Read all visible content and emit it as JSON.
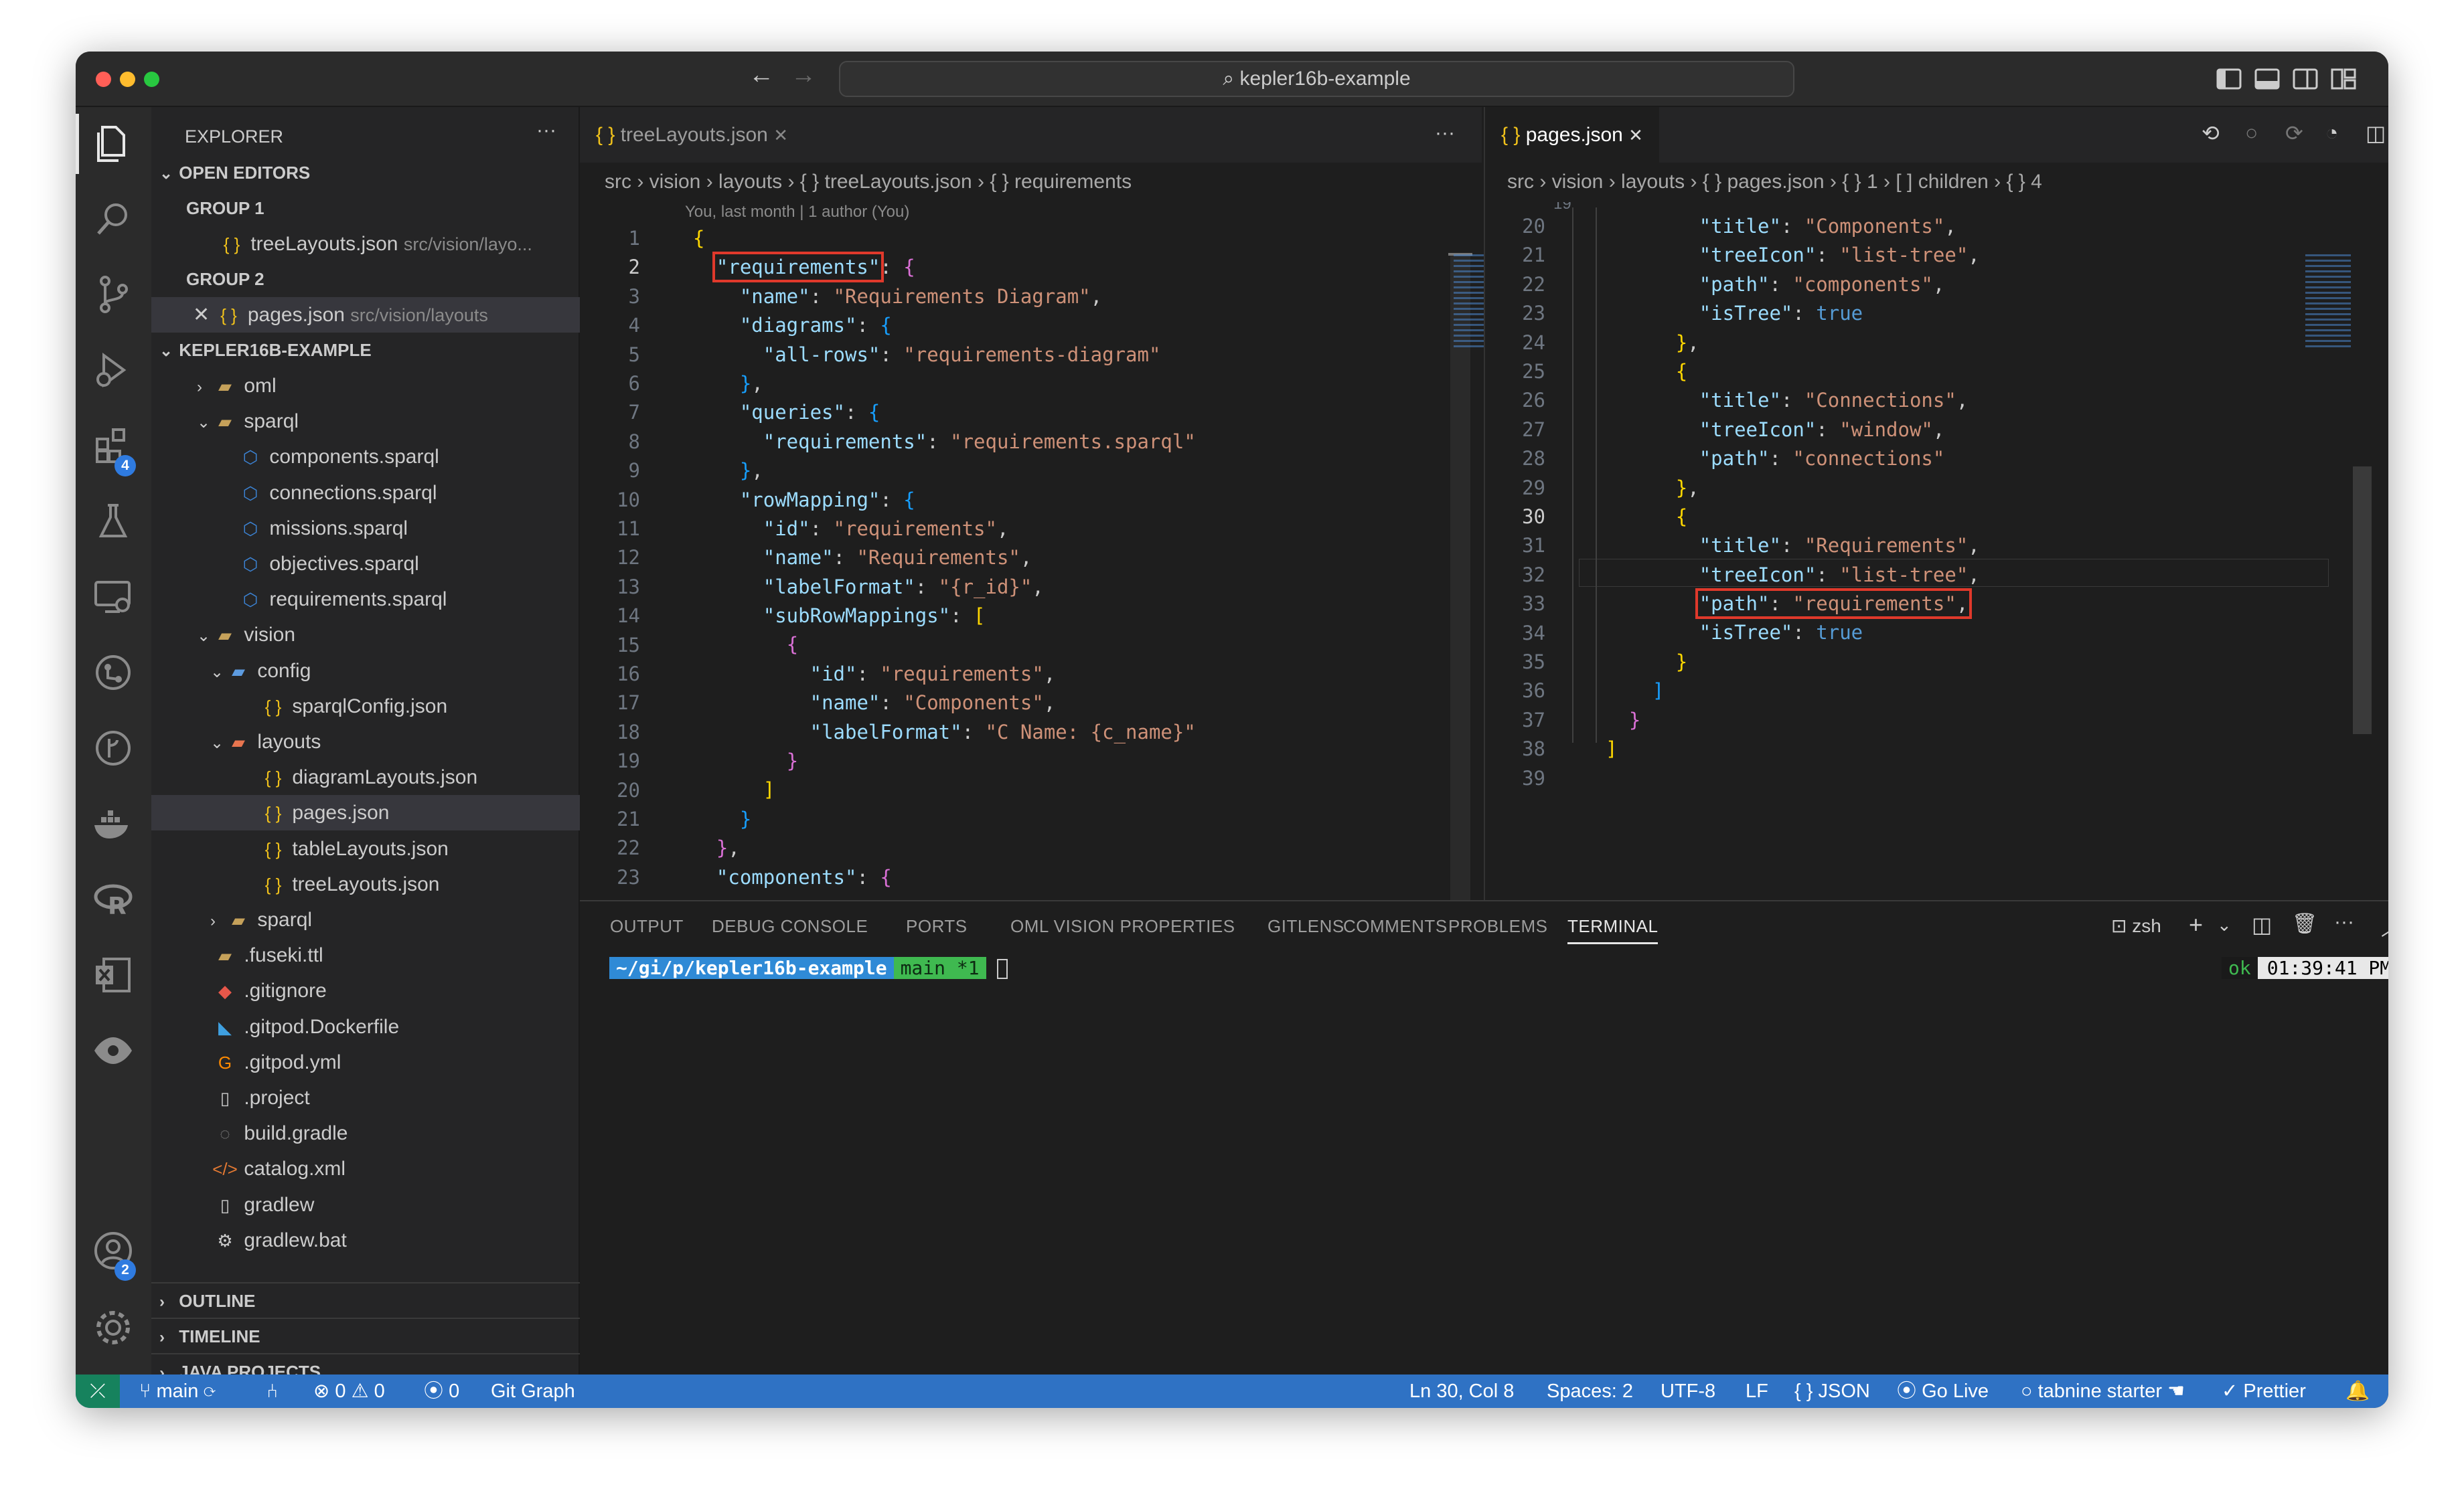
{
  "window_title": "kepler16b-example",
  "explorer": {
    "title": "EXPLORER",
    "open_editors": "OPEN EDITORS",
    "group1": "GROUP 1",
    "group1_file": "treeLayouts.json",
    "group1_path": "src/vision/layo...",
    "group2": "GROUP 2",
    "group2_file": "pages.json",
    "group2_path": "src/vision/layouts",
    "project": "KEPLER16B-EXAMPLE",
    "tree": [
      {
        "label": "oml",
        "icon": "folder-icon"
      },
      {
        "label": "sparql",
        "icon": "folder-open-icon"
      },
      {
        "label": "components.sparql",
        "icon": "sparql-file-icon"
      },
      {
        "label": "connections.sparql",
        "icon": "sparql-file-icon"
      },
      {
        "label": "missions.sparql",
        "icon": "sparql-file-icon"
      },
      {
        "label": "objectives.sparql",
        "icon": "sparql-file-icon"
      },
      {
        "label": "requirements.sparql",
        "icon": "sparql-file-icon"
      },
      {
        "label": "vision",
        "icon": "folder-open-icon"
      },
      {
        "label": "config",
        "icon": "config-folder-icon"
      },
      {
        "label": "sparqlConfig.json",
        "icon": "json-file-icon"
      },
      {
        "label": "layouts",
        "icon": "layout-folder-icon"
      },
      {
        "label": "diagramLayouts.json",
        "icon": "json-file-icon"
      },
      {
        "label": "pages.json",
        "icon": "json-file-icon"
      },
      {
        "label": "tableLayouts.json",
        "icon": "json-file-icon"
      },
      {
        "label": "treeLayouts.json",
        "icon": "json-file-icon"
      },
      {
        "label": "sparql",
        "icon": "folder-icon"
      },
      {
        "label": ".fuseki.ttl",
        "icon": "folder-icon"
      },
      {
        "label": ".gitignore",
        "icon": "git-icon"
      },
      {
        "label": ".gitpod.Dockerfile",
        "icon": "docker-icon"
      },
      {
        "label": ".gitpod.yml",
        "icon": "gitpod-icon"
      },
      {
        "label": ".project",
        "icon": "file-icon"
      },
      {
        "label": "build.gradle",
        "icon": "gradle-icon"
      },
      {
        "label": "catalog.xml",
        "icon": "xml-icon"
      },
      {
        "label": "gradlew",
        "icon": "file-icon"
      },
      {
        "label": "gradlew.bat",
        "icon": "gear-file-icon"
      }
    ],
    "outline": "OUTLINE",
    "timeline": "TIMELINE",
    "java_projects": "JAVA PROJECTS"
  },
  "left_editor": {
    "tab": "treeLayouts.json",
    "breadcrumb": [
      "src",
      "vision",
      "layouts",
      "{ } treeLayouts.json",
      "{ } requirements"
    ],
    "codelens": "You, last month | 1 author (You)",
    "line_numbers": [
      "1",
      "2",
      "3",
      "4",
      "5",
      "6",
      "7",
      "8",
      "9",
      "10",
      "11",
      "12",
      "13",
      "14",
      "15",
      "16",
      "17",
      "18",
      "19",
      "20",
      "21",
      "22",
      "23"
    ],
    "lines": [
      [
        [
          "b1",
          "{"
        ]
      ],
      [
        [
          "p",
          "  "
        ],
        [
          "k",
          "\"requirements\""
        ],
        [
          "p",
          ": "
        ],
        [
          "b2",
          "{"
        ]
      ],
      [
        [
          "p",
          "    "
        ],
        [
          "k",
          "\"name\""
        ],
        [
          "p",
          ": "
        ],
        [
          "s",
          "\"Requirements Diagram\""
        ],
        [
          "p",
          ","
        ]
      ],
      [
        [
          "p",
          "    "
        ],
        [
          "k",
          "\"diagrams\""
        ],
        [
          "p",
          ": "
        ],
        [
          "b3",
          "{"
        ]
      ],
      [
        [
          "p",
          "      "
        ],
        [
          "k",
          "\"all-rows\""
        ],
        [
          "p",
          ": "
        ],
        [
          "s",
          "\"requirements-diagram\""
        ]
      ],
      [
        [
          "p",
          "    "
        ],
        [
          "b3",
          "}"
        ],
        [
          "p",
          ","
        ]
      ],
      [
        [
          "p",
          "    "
        ],
        [
          "k",
          "\"queries\""
        ],
        [
          "p",
          ": "
        ],
        [
          "b3",
          "{"
        ]
      ],
      [
        [
          "p",
          "      "
        ],
        [
          "k",
          "\"requirements\""
        ],
        [
          "p",
          ": "
        ],
        [
          "s",
          "\"requirements.sparql\""
        ]
      ],
      [
        [
          "p",
          "    "
        ],
        [
          "b3",
          "}"
        ],
        [
          "p",
          ","
        ]
      ],
      [
        [
          "p",
          "    "
        ],
        [
          "k",
          "\"rowMapping\""
        ],
        [
          "p",
          ": "
        ],
        [
          "b3",
          "{"
        ]
      ],
      [
        [
          "p",
          "      "
        ],
        [
          "k",
          "\"id\""
        ],
        [
          "p",
          ": "
        ],
        [
          "s",
          "\"requirements\""
        ],
        [
          "p",
          ","
        ]
      ],
      [
        [
          "p",
          "      "
        ],
        [
          "k",
          "\"name\""
        ],
        [
          "p",
          ": "
        ],
        [
          "s",
          "\"Requirements\""
        ],
        [
          "p",
          ","
        ]
      ],
      [
        [
          "p",
          "      "
        ],
        [
          "k",
          "\"labelFormat\""
        ],
        [
          "p",
          ": "
        ],
        [
          "s",
          "\"{r_id}\""
        ],
        [
          "p",
          ","
        ]
      ],
      [
        [
          "p",
          "      "
        ],
        [
          "k",
          "\"subRowMappings\""
        ],
        [
          "p",
          ": "
        ],
        [
          "b1",
          "["
        ]
      ],
      [
        [
          "p",
          "        "
        ],
        [
          "b2",
          "{"
        ]
      ],
      [
        [
          "p",
          "          "
        ],
        [
          "k",
          "\"id\""
        ],
        [
          "p",
          ": "
        ],
        [
          "s",
          "\"requirements\""
        ],
        [
          "p",
          ","
        ]
      ],
      [
        [
          "p",
          "          "
        ],
        [
          "k",
          "\"name\""
        ],
        [
          "p",
          ": "
        ],
        [
          "s",
          "\"Components\""
        ],
        [
          "p",
          ","
        ]
      ],
      [
        [
          "p",
          "          "
        ],
        [
          "k",
          "\"labelFormat\""
        ],
        [
          "p",
          ": "
        ],
        [
          "s",
          "\"C Name: {c_name}\""
        ]
      ],
      [
        [
          "p",
          "        "
        ],
        [
          "b2",
          "}"
        ]
      ],
      [
        [
          "p",
          "      "
        ],
        [
          "b1",
          "]"
        ]
      ],
      [
        [
          "p",
          "    "
        ],
        [
          "b3",
          "}"
        ]
      ],
      [
        [
          "p",
          "  "
        ],
        [
          "b2",
          "}"
        ],
        [
          "p",
          ","
        ]
      ],
      [
        [
          "p",
          "  "
        ],
        [
          "k",
          "\"components\""
        ],
        [
          "p",
          ": "
        ],
        [
          "b2",
          "{"
        ]
      ]
    ]
  },
  "right_editor": {
    "tab": "pages.json",
    "breadcrumb": [
      "src",
      "vision",
      "layouts",
      "{ } pages.json",
      "{ } 1",
      "[ ] children",
      "{ } 4"
    ],
    "line_numbers": [
      "20",
      "21",
      "22",
      "23",
      "24",
      "25",
      "26",
      "27",
      "28",
      "29",
      "30",
      "31",
      "32",
      "33",
      "34",
      "35",
      "36",
      "37",
      "38",
      "39"
    ],
    "lines": [
      [
        [
          "p",
          "        "
        ],
        [
          "k",
          "\"title\""
        ],
        [
          "p",
          ": "
        ],
        [
          "s",
          "\"Components\""
        ],
        [
          "p",
          ","
        ]
      ],
      [
        [
          "p",
          "        "
        ],
        [
          "k",
          "\"treeIcon\""
        ],
        [
          "p",
          ": "
        ],
        [
          "s",
          "\"list-tree\""
        ],
        [
          "p",
          ","
        ]
      ],
      [
        [
          "p",
          "        "
        ],
        [
          "k",
          "\"path\""
        ],
        [
          "p",
          ": "
        ],
        [
          "s",
          "\"components\""
        ],
        [
          "p",
          ","
        ]
      ],
      [
        [
          "p",
          "        "
        ],
        [
          "k",
          "\"isTree\""
        ],
        [
          "p",
          ": "
        ],
        [
          "kw",
          "true"
        ]
      ],
      [
        [
          "p",
          "      "
        ],
        [
          "b1",
          "}"
        ],
        [
          "p",
          ","
        ]
      ],
      [
        [
          "p",
          "      "
        ],
        [
          "b1",
          "{"
        ]
      ],
      [
        [
          "p",
          "        "
        ],
        [
          "k",
          "\"title\""
        ],
        [
          "p",
          ": "
        ],
        [
          "s",
          "\"Connections\""
        ],
        [
          "p",
          ","
        ]
      ],
      [
        [
          "p",
          "        "
        ],
        [
          "k",
          "\"treeIcon\""
        ],
        [
          "p",
          ": "
        ],
        [
          "s",
          "\"window\""
        ],
        [
          "p",
          ","
        ]
      ],
      [
        [
          "p",
          "        "
        ],
        [
          "k",
          "\"path\""
        ],
        [
          "p",
          ": "
        ],
        [
          "s",
          "\"connections\""
        ]
      ],
      [
        [
          "p",
          "      "
        ],
        [
          "b1",
          "}"
        ],
        [
          "p",
          ","
        ]
      ],
      [
        [
          "p",
          "      "
        ],
        [
          "b1",
          "{"
        ]
      ],
      [
        [
          "p",
          "        "
        ],
        [
          "k",
          "\"title\""
        ],
        [
          "p",
          ": "
        ],
        [
          "s",
          "\"Requirements\""
        ],
        [
          "p",
          ","
        ]
      ],
      [
        [
          "p",
          "        "
        ],
        [
          "k",
          "\"treeIcon\""
        ],
        [
          "p",
          ": "
        ],
        [
          "s",
          "\"list-tree\""
        ],
        [
          "p",
          ","
        ]
      ],
      [
        [
          "p",
          "        "
        ],
        [
          "k",
          "\"path\""
        ],
        [
          "p",
          ": "
        ],
        [
          "s",
          "\"requirements\""
        ],
        [
          "p",
          ","
        ]
      ],
      [
        [
          "p",
          "        "
        ],
        [
          "k",
          "\"isTree\""
        ],
        [
          "p",
          ": "
        ],
        [
          "kw",
          "true"
        ]
      ],
      [
        [
          "p",
          "      "
        ],
        [
          "b1",
          "}"
        ]
      ],
      [
        [
          "p",
          "    "
        ],
        [
          "b3",
          "]"
        ]
      ],
      [
        [
          "p",
          "  "
        ],
        [
          "b2",
          "}"
        ]
      ],
      [
        [
          "b1",
          "]"
        ]
      ],
      [
        [
          "p",
          ""
        ]
      ]
    ]
  },
  "panel": {
    "tabs": [
      "OUTPUT",
      "DEBUG CONSOLE",
      "PORTS",
      "OML VISION PROPERTIES",
      "GITLENS",
      "COMMENTS",
      "PROBLEMS",
      "TERMINAL"
    ],
    "shell": "zsh",
    "prompt_path": "~/gi/p/kepler16b-example",
    "prompt_branch": "main *1",
    "status_ok": "ok",
    "status_time": "01:39:41 PM"
  },
  "statusbar": {
    "branch": "main",
    "errors": "0",
    "warnings": "0",
    "ports": "0",
    "git_graph": "Git Graph",
    "position": "Ln 30, Col 8",
    "spaces": "Spaces: 2",
    "encoding": "UTF-8",
    "eol": "LF",
    "language": "JSON",
    "golive": "Go Live",
    "tabnine": "tabnine starter",
    "prettier": "Prettier"
  },
  "badges": {
    "extensions": "4",
    "accounts": "2"
  },
  "colors": {
    "status_bar": "#2f72c4",
    "highlight": "#e0392b",
    "terminal_path_bg": "#2f8ad6",
    "terminal_branch_bg": "#3fb950"
  }
}
